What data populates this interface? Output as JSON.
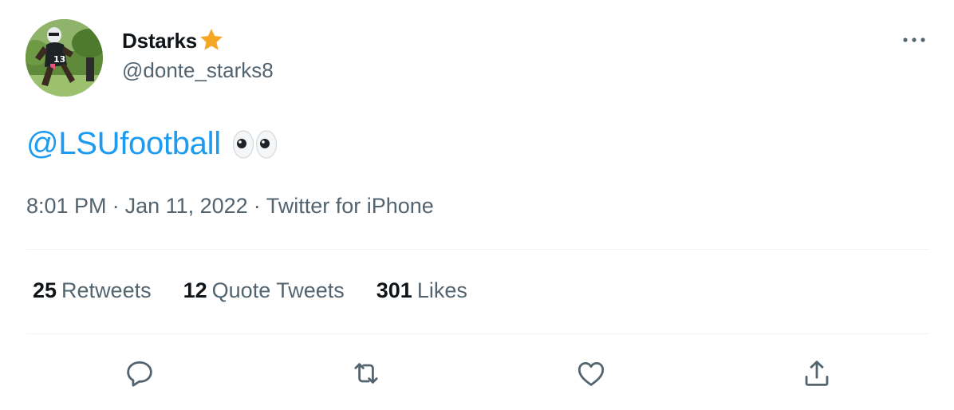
{
  "author": {
    "display_name": "Dstarks",
    "handle": "@donte_starks8",
    "avatar_jersey_number": "13"
  },
  "tweet": {
    "mention": "@LSUfootball",
    "emoji": "eyes-icon"
  },
  "meta": {
    "time": "8:01 PM",
    "separator": "·",
    "date": "Jan 11, 2022",
    "source": "Twitter for iPhone"
  },
  "stats": [
    {
      "count": "25",
      "label": "Retweets"
    },
    {
      "count": "12",
      "label": "Quote Tweets"
    },
    {
      "count": "301",
      "label": "Likes"
    }
  ],
  "icons": {
    "star": "star-icon",
    "more": "more-horizontal-icon",
    "reply": "reply-icon",
    "retweet": "retweet-icon",
    "like": "heart-icon",
    "share": "share-icon"
  },
  "colors": {
    "accent": "#1d9bf0",
    "text_primary": "#0f1419",
    "text_secondary": "#536471",
    "divider": "#eff3f4",
    "star": "#f5a623"
  }
}
